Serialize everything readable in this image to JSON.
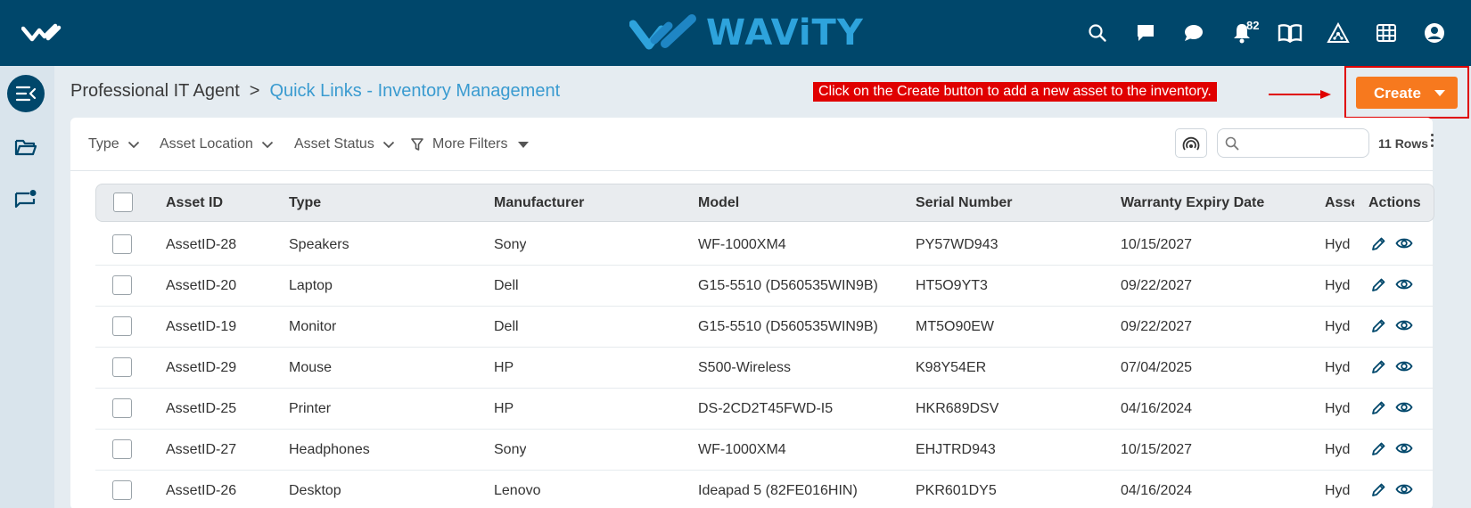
{
  "header": {
    "brand": "WAViTY",
    "notification_count": "82",
    "icons": [
      "search-icon",
      "chat-square-icon",
      "chat-bubble-icon",
      "bell-icon",
      "book-icon",
      "network-icon",
      "grid-icon",
      "user-icon"
    ]
  },
  "sidebar": {
    "items": [
      "collapse-menu-icon",
      "folder-icon",
      "message-icon"
    ]
  },
  "breadcrumb": {
    "root": "Professional IT Agent",
    "separator": ">",
    "current": "Quick Links - Inventory Management"
  },
  "callout": {
    "text": "Click on the Create button to add a new asset to the inventory."
  },
  "create_button": {
    "label": "Create"
  },
  "filters": {
    "type": "Type",
    "asset_location": "Asset Location",
    "asset_status": "Asset Status",
    "more_filters": "More Filters"
  },
  "search": {
    "value": "",
    "placeholder": ""
  },
  "rows_count": "11 Rows",
  "table": {
    "columns": [
      "Asset ID",
      "Type",
      "Manufacturer",
      "Model",
      "Serial Number",
      "Warranty Expiry Date",
      "Asse",
      "Actions"
    ],
    "rows": [
      {
        "asset_id": "AssetID-28",
        "type": "Speakers",
        "manufacturer": "Sony",
        "model": "WF-1000XM4",
        "serial": "PY57WD943",
        "warranty": "10/15/2027",
        "location": "Hyd"
      },
      {
        "asset_id": "AssetID-20",
        "type": "Laptop",
        "manufacturer": "Dell",
        "model": "G15-5510 (D560535WIN9B)",
        "serial": "HT5O9YT3",
        "warranty": "09/22/2027",
        "location": "Hyd"
      },
      {
        "asset_id": "AssetID-19",
        "type": "Monitor",
        "manufacturer": "Dell",
        "model": "G15-5510 (D560535WIN9B)",
        "serial": "MT5O90EW",
        "warranty": "09/22/2027",
        "location": "Hyd"
      },
      {
        "asset_id": "AssetID-29",
        "type": "Mouse",
        "manufacturer": "HP",
        "model": "S500-Wireless",
        "serial": "K98Y54ER",
        "warranty": "07/04/2025",
        "location": "Hyd"
      },
      {
        "asset_id": "AssetID-25",
        "type": "Printer",
        "manufacturer": "HP",
        "model": "DS-2CD2T45FWD-I5",
        "serial": "HKR689DSV",
        "warranty": "04/16/2024",
        "location": "Hyd"
      },
      {
        "asset_id": "AssetID-27",
        "type": "Headphones",
        "manufacturer": "Sony",
        "model": "WF-1000XM4",
        "serial": "EHJTRD943",
        "warranty": "10/15/2027",
        "location": "Hyd"
      },
      {
        "asset_id": "AssetID-26",
        "type": "Desktop",
        "manufacturer": "Lenovo",
        "model": "Ideapad 5 (82FE016HIN)",
        "serial": "PKR601DY5",
        "warranty": "04/16/2024",
        "location": "Hyd"
      }
    ]
  },
  "colors": {
    "header_bg": "#00476b",
    "brand_blue": "#2ea3dc",
    "link_blue": "#3a9bd0",
    "create_orange": "#f7791e",
    "callout_red": "#e00000"
  }
}
